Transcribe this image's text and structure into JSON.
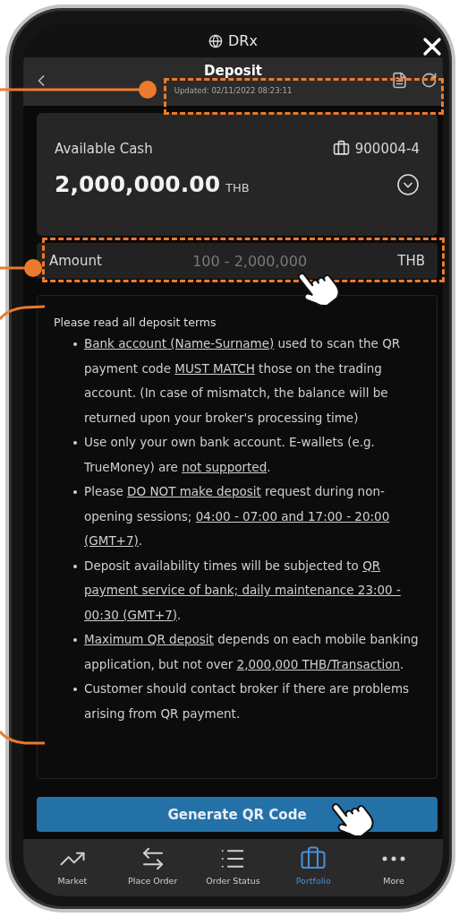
{
  "app_bar": {
    "title": "DRx"
  },
  "header": {
    "title": "Deposit",
    "updated": "Updated: 02/11/2022 08:23:11"
  },
  "cash_card": {
    "label": "Available Cash",
    "account": "900004-4",
    "amount": "2,000,000.00",
    "currency": "THB"
  },
  "amount_field": {
    "label": "Amount",
    "placeholder": "100 - 2,000,000",
    "unit": "THB"
  },
  "terms": {
    "heading": "Please read all deposit terms",
    "items": [
      [
        {
          "text": "Bank account (Name-Surname)",
          "underline": true
        },
        {
          "text": " used to scan the QR payment code ",
          "underline": false
        },
        {
          "text": "MUST MATCH",
          "underline": true
        },
        {
          "text": " those on the trading account. (In case of mismatch, the balance will be returned upon your broker's processing time)",
          "underline": false
        }
      ],
      [
        {
          "text": "Use only your own bank account. E-wallets (e.g. TrueMoney) are ",
          "underline": false
        },
        {
          "text": "not supported",
          "underline": true
        },
        {
          "text": ".",
          "underline": false
        }
      ],
      [
        {
          "text": "Please ",
          "underline": false
        },
        {
          "text": "DO NOT make deposit",
          "underline": true
        },
        {
          "text": " request during non-opening sessions; ",
          "underline": false
        },
        {
          "text": "04:00 - 07:00 and 17:00 - 20:00 (GMT+7)",
          "underline": true
        },
        {
          "text": ".",
          "underline": false
        }
      ],
      [
        {
          "text": "Deposit availability times will be subjected to ",
          "underline": false
        },
        {
          "text": "QR payment service of bank; daily maintenance 23:00 - 00:30 (GMT+7)",
          "underline": true
        },
        {
          "text": ".",
          "underline": false
        }
      ],
      [
        {
          "text": "Maximum QR deposit",
          "underline": true
        },
        {
          "text": " depends on each mobile banking application, but not over ",
          "underline": false
        },
        {
          "text": "2,000,000 THB/Transaction",
          "underline": true
        },
        {
          "text": ".",
          "underline": false
        }
      ],
      [
        {
          "text": "Customer should contact broker if there are problems arising from QR payment.",
          "underline": false
        }
      ]
    ]
  },
  "primary_button": "Generate QR Code",
  "tab_bar": [
    {
      "kind": "market",
      "label": "Market",
      "selected": false
    },
    {
      "kind": "order",
      "label": "Place Order",
      "selected": false
    },
    {
      "kind": "status",
      "label": "Order Status",
      "selected": false
    },
    {
      "kind": "portfolio",
      "label": "Portfolio",
      "selected": true
    },
    {
      "kind": "more",
      "label": "More",
      "selected": false
    }
  ]
}
